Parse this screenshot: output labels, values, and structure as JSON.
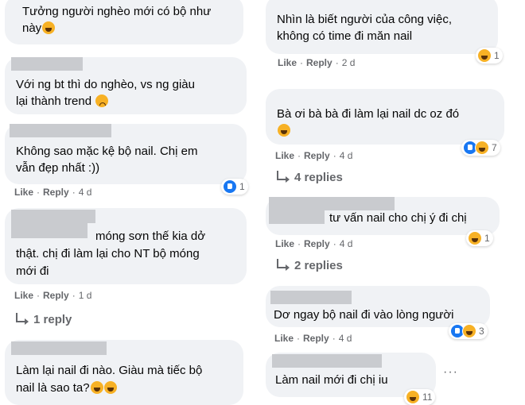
{
  "left": [
    {
      "text1": "Tưởng người nghèo mới có bộ như",
      "text2": "này",
      "inline_icon": "laugh"
    },
    {
      "text1": "Với ng bt thì do nghèo, vs ng giàu",
      "text2": "lại thành trend",
      "inline_icon": "sad"
    },
    {
      "text": "Không sao mặc kệ bộ nail. Chị em\nvẫn đẹp nhất :))",
      "like": "Like",
      "reply": "Reply",
      "time": "4 d",
      "react_icons": [
        "like-icon"
      ],
      "react_count": "1"
    },
    {
      "line1": "móng sơn thế kia dở",
      "line2": "thật. chị đi làm lại cho NT bộ móng",
      "line3": "mới đi",
      "like": "Like",
      "reply": "Reply",
      "time": "1 d",
      "replies": "1 reply"
    },
    {
      "line1": "Làm lại nail đi nào. Giàu mà tiếc bộ",
      "line2": "nail là sao ta?"
    }
  ],
  "right": [
    {
      "text": "Nhìn là biết người của công việc,\nkhông có time đi măn nail",
      "like": "Like",
      "reply": "Reply",
      "time": "2 d",
      "react_icons": [
        "haha-icon"
      ],
      "react_count": "1"
    },
    {
      "text": "Bà ơi bà bà đi làm lại nail dc oz đó",
      "like": "Like",
      "reply": "Reply",
      "time": "4 d",
      "react_icons": [
        "like-icon",
        "haha-icon"
      ],
      "react_count": "7",
      "replies": "4 replies"
    },
    {
      "text": "tư vấn nail cho chị ý đi chị",
      "like": "Like",
      "reply": "Reply",
      "time": "4 d",
      "react_icons": [
        "haha-icon"
      ],
      "react_count": "1",
      "replies": "2 replies"
    },
    {
      "text": "Dơ ngay bộ nail đi vào lòng người",
      "like": "Like",
      "reply": "Reply",
      "time": "4 d",
      "react_icons": [
        "like-icon",
        "haha-icon"
      ],
      "react_count": "3"
    },
    {
      "text": "Làm nail mới đi chị iu",
      "react_count": "11",
      "more": "···"
    }
  ]
}
